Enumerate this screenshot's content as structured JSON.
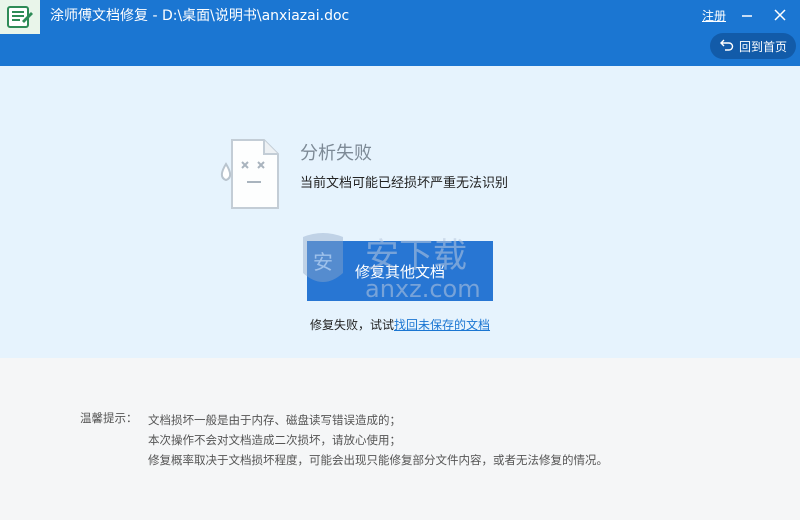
{
  "window": {
    "title": "涂师傅文档修复 - D:\\桌面\\说明书\\anxiazai.doc",
    "register_label": "注册",
    "home_label": "回到首页",
    "accent_color": "#1b76d2"
  },
  "result": {
    "title": "分析失败",
    "description": "当前文档可能已经损坏严重无法识别",
    "repair_other_label": "修复其他文档",
    "retry_prefix": "修复失败，试试",
    "recover_link": "找回未保存的文档"
  },
  "watermark": {
    "cn": "安下载",
    "en": "anxz.com"
  },
  "tips": {
    "label": "温馨提示：",
    "lines": [
      "文档损坏一般是由于内存、磁盘读写错误造成的；",
      "本次操作不会对文档造成二次损坏，请放心使用；",
      "修复概率取决于文档损坏程度，可能会出现只能修复部分文件内容，或者无法修复的情况。"
    ]
  },
  "icons": [
    "app-logo-icon",
    "minimize-icon",
    "close-icon",
    "back-arrow-icon",
    "broken-document-icon"
  ]
}
